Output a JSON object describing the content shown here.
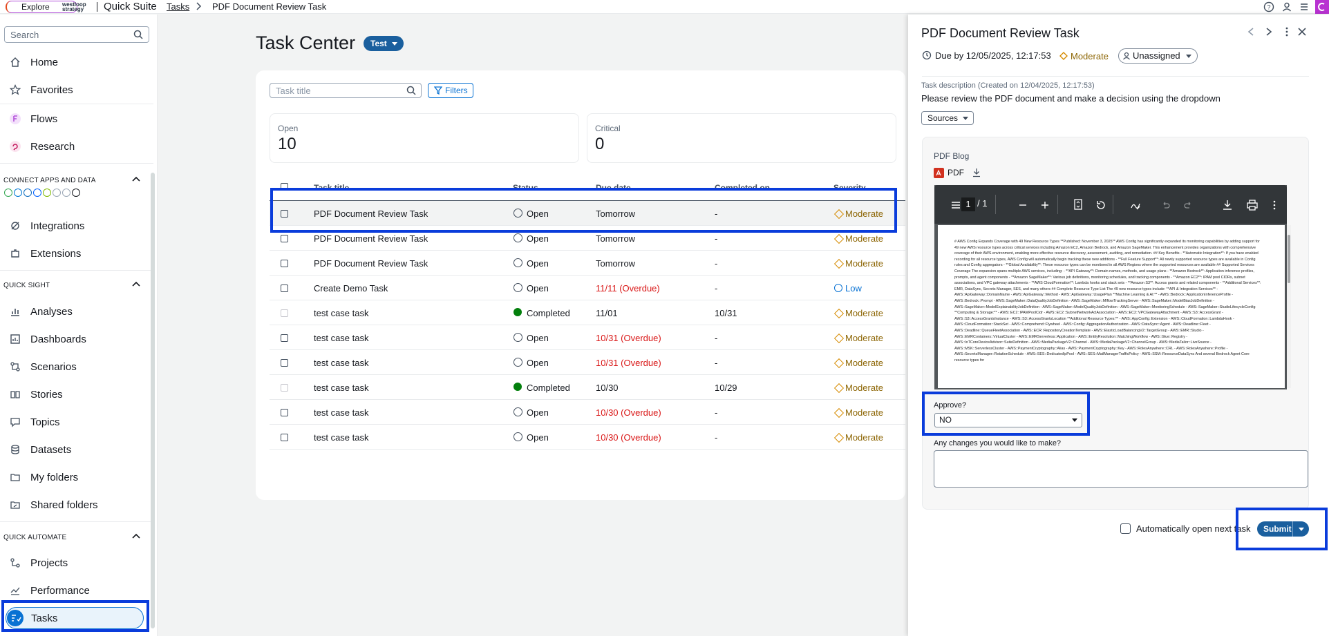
{
  "topbar": {
    "explore_label": "Explore",
    "logo_text": "westloop strategy",
    "app_name": "Quick Suite",
    "breadcrumb": [
      "Tasks",
      "PDF Document Review Task"
    ]
  },
  "sidebar": {
    "search_placeholder": "Search",
    "top_items": [
      {
        "label": "Home",
        "icon": "home-icon"
      },
      {
        "label": "Favorites",
        "icon": "star-icon"
      },
      {
        "label": "Flows",
        "icon": "flows-icon"
      },
      {
        "label": "Research",
        "icon": "research-icon"
      }
    ],
    "connect_header": "CONNECT APPS AND DATA",
    "connect_items": [
      {
        "label": "Integrations",
        "icon": "integrations-icon"
      },
      {
        "label": "Extensions",
        "icon": "extensions-icon"
      }
    ],
    "quicksight_header": "QUICK SIGHT",
    "quicksight_items": [
      {
        "label": "Analyses",
        "icon": "analyses-icon"
      },
      {
        "label": "Dashboards",
        "icon": "dashboards-icon"
      },
      {
        "label": "Scenarios",
        "icon": "scenarios-icon"
      },
      {
        "label": "Stories",
        "icon": "stories-icon"
      },
      {
        "label": "Topics",
        "icon": "topics-icon"
      },
      {
        "label": "Datasets",
        "icon": "datasets-icon"
      },
      {
        "label": "My folders",
        "icon": "folder-icon"
      },
      {
        "label": "Shared folders",
        "icon": "shared-folder-icon"
      }
    ],
    "automate_header": "QUICK AUTOMATE",
    "automate_items": [
      {
        "label": "Projects",
        "icon": "projects-icon"
      },
      {
        "label": "Performance",
        "icon": "performance-icon"
      },
      {
        "label": "Tasks",
        "icon": "tasks-icon",
        "selected": true
      }
    ]
  },
  "main": {
    "title": "Task Center",
    "env_badge": "Test",
    "search_placeholder": "Task title",
    "filters_label": "Filters",
    "stats": [
      {
        "label": "Open",
        "value": "10"
      },
      {
        "label": "Critical",
        "value": "0"
      }
    ],
    "columns": [
      "Task title",
      "Status",
      "Due date",
      "Completed on",
      "Severity"
    ],
    "rows": [
      {
        "title": "PDF Document Review Task",
        "status": "Open",
        "due": "Tomorrow",
        "completed": "-",
        "severity": "Moderate",
        "overdue": false
      },
      {
        "title": "PDF Document Review Task",
        "status": "Open",
        "due": "Tomorrow",
        "completed": "-",
        "severity": "Moderate",
        "overdue": false
      },
      {
        "title": "PDF Document Review Task",
        "status": "Open",
        "due": "Tomorrow",
        "completed": "-",
        "severity": "Moderate",
        "overdue": false
      },
      {
        "title": "Create Demo Task",
        "status": "Open",
        "due": "11/11 (Overdue)",
        "completed": "-",
        "severity": "Low",
        "overdue": true
      },
      {
        "title": "test case task",
        "status": "Completed",
        "due": "11/01",
        "completed": "10/31",
        "severity": "Moderate",
        "overdue": false
      },
      {
        "title": "test case task",
        "status": "Open",
        "due": "10/31 (Overdue)",
        "completed": "-",
        "severity": "Moderate",
        "overdue": true
      },
      {
        "title": "test case task",
        "status": "Open",
        "due": "10/31 (Overdue)",
        "completed": "-",
        "severity": "Moderate",
        "overdue": true
      },
      {
        "title": "test case task",
        "status": "Completed",
        "due": "10/30",
        "completed": "10/29",
        "severity": "Moderate",
        "overdue": false
      },
      {
        "title": "test case task",
        "status": "Open",
        "due": "10/30 (Overdue)",
        "completed": "-",
        "severity": "Moderate",
        "overdue": true
      },
      {
        "title": "test case task",
        "status": "Open",
        "due": "10/30 (Overdue)",
        "completed": "-",
        "severity": "Moderate",
        "overdue": true
      }
    ]
  },
  "panel": {
    "title": "PDF Document Review Task",
    "due": "Due by 12/05/2025, 12:17:53",
    "severity": "Moderate",
    "assignee": "Unassigned",
    "desc_header": "Task description (Created on 12/04/2025, 12:17:53)",
    "description": "Please review the PDF document and make a decision using the dropdown",
    "sources_label": "Sources",
    "pdf_section_label": "PDF Blog",
    "pdf_file_label": "PDF",
    "pdf_page_current": "1",
    "pdf_page_total": "/ 1",
    "pdf_text": "# AWS Config Expands Coverage with 49 New Resource Types **Published: November 3, 2025** AWS Config has significantly expanded its monitoring capabilities by adding support for 49 new AWS resource types across critical services including Amazon EC2, Amazon Bedrock, and Amazon SageMaker. This enhancement provides organizations with comprehensive coverage of their AWS environment, enabling more effective resource discovery, assessment, auditing, and remediation. ## Key Benefits - **Automatic Integration**: If you have enabled recording for all resource types, AWS Config will automatically begin tracking these new additions - **Full Feature Support**: All newly supported resource types are available in Config rules and Config aggregators - **Global Availability**: These resource types can be monitored in all AWS Regions where the supported resources are available ## Supported Services Coverage The expansion spans multiple AWS services, including: - **API Gateway**: Domain names, methods, and usage plans - **Amazon Bedrock**: Application inference profiles, prompts, and agent components - **Amazon SageMaker**: Various job definitions, monitoring schedules, and tracking components - **Amazon EC2**: IPAM pool CIDRs, subnet associations, and VPC gateway attachments - **AWS CloudFormation**: Lambda hooks and stack sets - **Amazon S3**: Access grants and related components - **Additional Services**: EMR, DataSync, Secrets Manager, SES, and many others ## Complete Resource Type List The 49 new resource types include: **API & Integration Services** - AWS::ApiGateway::DomainName - AWS::ApiGateway::Method - AWS::ApiGateway::UsagePlan **Machine Learning & AI:** - AWS::Bedrock::ApplicationInferenceProfile - AWS::Bedrock::Prompt - AWS::SageMaker::DataQualityJobDefinition - AWS::SageMaker::MlflowTrackingServer - AWS::SageMaker::ModelBiasJobDefinition - AWS::SageMaker::ModelExplainabilityJobDefinition - AWS::SageMaker::ModelQualityJobDefinition - AWS::SageMaker::MonitoringSchedule - AWS::SageMaker::StudioLifecycleConfig **Computing & Storage:** - AWS::EC2::IPAMPoolCidr - AWS::EC2::SubnetNetworkAclAssociation - AWS::EC2::VPCGatewayAttachment - AWS::S3::AccessGrant - AWS::S3::AccessGrantsInstance - AWS::S3::AccessGrantsLocation **Additional Resource Types:** - AWS::AppConfig::Extension - AWS::CloudFormation::LambdaHook - AWS::CloudFormation::StackSet - AWS::Comprehend::Flywheel - AWS::Config::AggregationAuthorization - AWS::DataSync::Agent - AWS::Deadline::Fleet - AWS::Deadline::QueueFleetAssociation - AWS::ECR::RepositoryCreationTemplate - AWS::ElasticLoadBalancingV2::TargetGroup - AWS::EMR::Studio - AWS::EMRContainers::VirtualCluster - AWS::EMRServerless::Application - AWS::EntityResolution::MatchingWorkflow - AWS::Glue::Registry - AWS::IoTCoreDeviceAdvisor::SuiteDefinition - AWS::MediaPackageV2::Channel - AWS::MediaPackageV2::ChannelGroup - AWS::MediaTailor::LiveSource - AWS::MSK::ServerlessCluster - AWS::PaymentCryptography::Alias - AWS::PaymentCryptography::Key - AWS::RolesAnywhere::CRL - AWS::RolesAnywhere::Profile - AWS::SecretsManager::RotationSchedule - AWS::SES::DedicatedIpPool - AWS::SES::MailManagerTrafficPolicy - AWS::SSM::ResourceDataSync And several Bedrock Agent Core resource types for",
    "approve_label": "Approve?",
    "approve_value": "NO",
    "changes_label": "Any changes you would like to make?",
    "auto_open_label": "Automatically open next task",
    "submit_label": "Submit"
  },
  "colors": {
    "accent": "#1a5f9e",
    "highlight": "#0a3cdb",
    "overdue": "#d91515",
    "moderate": "#8d6605",
    "low": "#0972d3",
    "completed": "#037f0c"
  }
}
